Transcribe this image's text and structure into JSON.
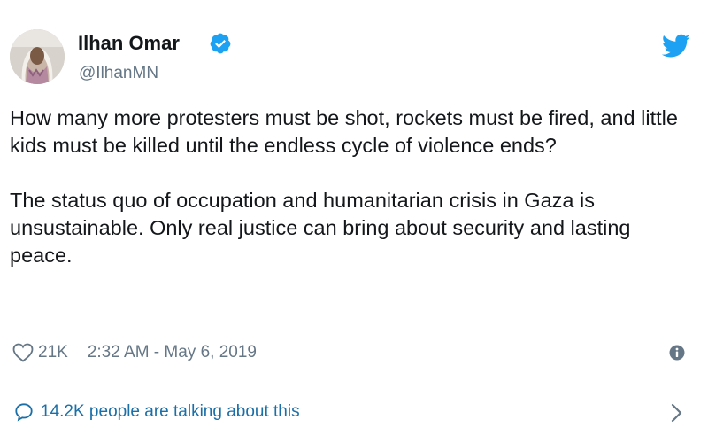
{
  "author": {
    "display_name": "Ilhan Omar",
    "handle": "@IlhanMN",
    "verified": true,
    "avatar_icon": "avatar-photo"
  },
  "tweet": {
    "paragraphs": [
      "How many more protesters must be shot, rockets must be fired, and little kids must be killed until the endless cycle of violence ends?",
      "The status quo of occupation and humanitarian crisis in Gaza is unsustainable. Only real justice can bring about security and lasting peace."
    ],
    "likes": "21K",
    "timestamp": "2:32 AM - May 6, 2019"
  },
  "footer": {
    "talking_label": "14.2K people are talking about this"
  },
  "colors": {
    "twitter_blue": "#1da1f2",
    "link_blue": "#1b6fa8",
    "text": "#14171a",
    "muted": "#657786"
  },
  "icons": {
    "verified": "verified-badge-icon",
    "brand": "twitter-bird-icon",
    "like": "heart-icon",
    "info": "info-icon",
    "conversation": "speech-bubble-icon",
    "more": "chevron-right-icon"
  }
}
